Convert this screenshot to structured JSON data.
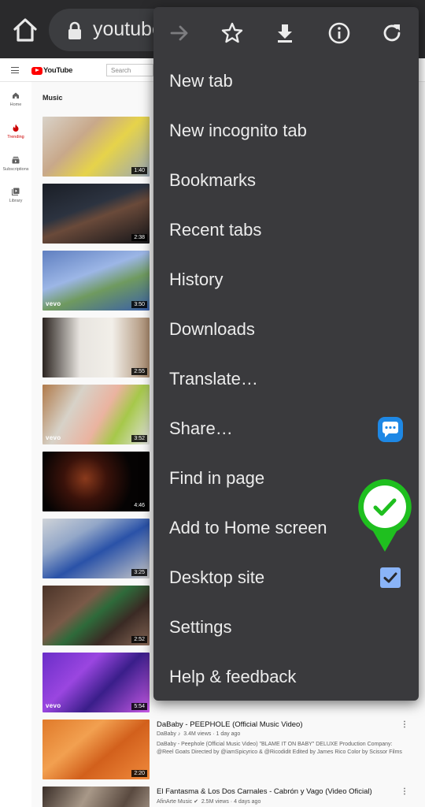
{
  "browser": {
    "url_text": "youtube.com"
  },
  "yt": {
    "logo_text": "YouTube",
    "search_placeholder": "Search",
    "sidebar": [
      {
        "label": "Home",
        "icon": "home-icon"
      },
      {
        "label": "Trending",
        "icon": "flame-icon"
      },
      {
        "label": "Subscriptions",
        "icon": "subscriptions-icon"
      },
      {
        "label": "Library",
        "icon": "library-icon"
      }
    ],
    "section_title": "Music",
    "durations": [
      "1:40",
      "2:38",
      "3:50",
      "2:55",
      "3:52",
      "4:46",
      "3:25",
      "2:52",
      "5:54",
      "2:20",
      ""
    ],
    "vevo_label": "vevo",
    "videos": [
      {
        "title": "DaBaby - PEEPHOLE (Official Music Video)",
        "channel": "DaBaby",
        "channel_mark": "♪",
        "views": "3.4M views",
        "age": "1 day ago",
        "description": "DaBaby - Peephole (Official Music Video) \"BLAME IT ON BABY\" DELUXE Production Company: @Reel Goats Directed by @iamSpicyrico & @Ricodidit Edited by James Rico Color by Scissor Films"
      },
      {
        "title": "El Fantasma & Los Dos Carnales - Cabrón y Vago (Video Oficial)",
        "channel": "AfinArte Music",
        "channel_mark": "✔",
        "views": "2.5M views",
        "age": "4 days ago",
        "description": ""
      }
    ],
    "more_glyph": "⋮"
  },
  "menu": {
    "items": [
      "New tab",
      "New incognito tab",
      "Bookmarks",
      "Recent tabs",
      "History",
      "Downloads",
      "Translate…",
      "Share…",
      "Find in page",
      "Add to Home screen",
      "Desktop site",
      "Settings",
      "Help & feedback"
    ],
    "desktop_site_checked": true
  },
  "colors": {
    "menu_bg": "#3a3a3d",
    "topbar_bg": "#2a2a2c",
    "checkbox": "#8ab4f8",
    "pin_green": "#1fbf1f",
    "share_blue": "#1e88e5"
  }
}
